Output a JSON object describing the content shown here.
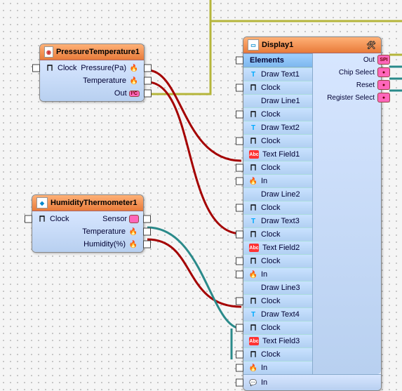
{
  "nodes": {
    "pressure": {
      "title": "PressureTemperature1",
      "clock": "Clock",
      "outputs": {
        "pressure": "Pressure(Pa)",
        "temperature": "Temperature",
        "bus": "Out"
      }
    },
    "humidity": {
      "title": "HumidityThermometer1",
      "clock": "Clock",
      "outputs": {
        "sensor": "Sensor",
        "temperature": "Temperature",
        "humidity": "Humidity(%)"
      }
    },
    "display": {
      "title": "Display1",
      "rightPorts": {
        "out": "Out",
        "chipSelect": "Chip Select",
        "reset": "Reset",
        "registerSelect": "Register Select"
      },
      "elementsHeader": "Elements",
      "elements": [
        {
          "kind": "text",
          "name": "Draw Text1",
          "ports": [
            "Clock"
          ]
        },
        {
          "kind": "line",
          "name": "Draw Line1",
          "ports": [
            "Clock"
          ]
        },
        {
          "kind": "text",
          "name": "Draw Text2",
          "ports": [
            "Clock"
          ]
        },
        {
          "kind": "field",
          "name": "Text Field1",
          "ports": [
            "Clock",
            "In"
          ]
        },
        {
          "kind": "line",
          "name": "Draw Line2",
          "ports": [
            "Clock"
          ]
        },
        {
          "kind": "text",
          "name": "Draw Text3",
          "ports": [
            "Clock"
          ]
        },
        {
          "kind": "field",
          "name": "Text Field2",
          "ports": [
            "Clock",
            "In"
          ]
        },
        {
          "kind": "line",
          "name": "Draw Line3",
          "ports": [
            "Clock"
          ]
        },
        {
          "kind": "text",
          "name": "Draw Text4",
          "ports": [
            "Clock"
          ]
        },
        {
          "kind": "field",
          "name": "Text Field3",
          "ports": [
            "Clock",
            "In"
          ]
        }
      ],
      "bottomIn": "In",
      "outBadge": "SPI"
    }
  },
  "wires": [
    {
      "from": "pressure.pressure",
      "to": "display.TextField1.In",
      "color": "#a40000"
    },
    {
      "from": "pressure.temperature",
      "to": "display.TextField2.In",
      "color": "#a40000"
    },
    {
      "from": "humidity.humidity",
      "to": "display.TextField3.In",
      "color": "#a40000"
    },
    {
      "from": "humidity.temperature",
      "to": "display.In",
      "color": "#2a8a8a"
    },
    {
      "from": "pressure.bus",
      "to": "top-offscreen",
      "color": "#a9a93a"
    },
    {
      "from": "display.Out",
      "to": "right-offscreen",
      "color": "#a9a93a"
    },
    {
      "from": "display.ChipSelect",
      "to": "right-offscreen",
      "color": "#2a8a8a"
    },
    {
      "from": "display.Reset",
      "to": "right-offscreen",
      "color": "#2a8a8a"
    },
    {
      "from": "display.RegisterSelect",
      "to": "right-offscreen",
      "color": "#2a8a8a"
    }
  ]
}
